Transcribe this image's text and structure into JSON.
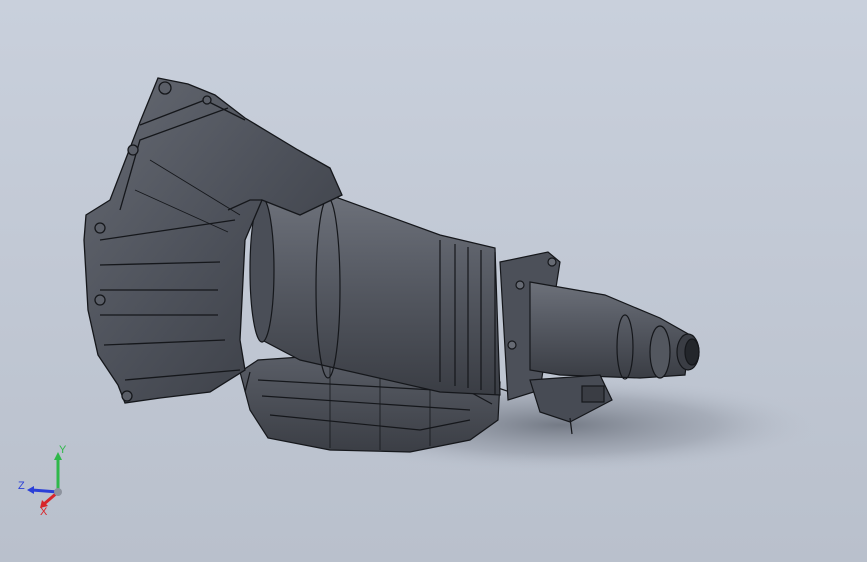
{
  "viewport": {
    "background_top": "#c9d0dc",
    "background_bottom": "#b9c0cc"
  },
  "model": {
    "icon": "transmission-model",
    "body_color": "#4b4f58",
    "highlight_color": "#6a6f79",
    "shadow_color": "#2f3238",
    "edge_color": "#15171b"
  },
  "triad": {
    "x_label": "X",
    "y_label": "Y",
    "z_label": "Z",
    "x_color": "#d8262a",
    "y_color": "#2fb84a",
    "z_color": "#2a3fd8"
  }
}
